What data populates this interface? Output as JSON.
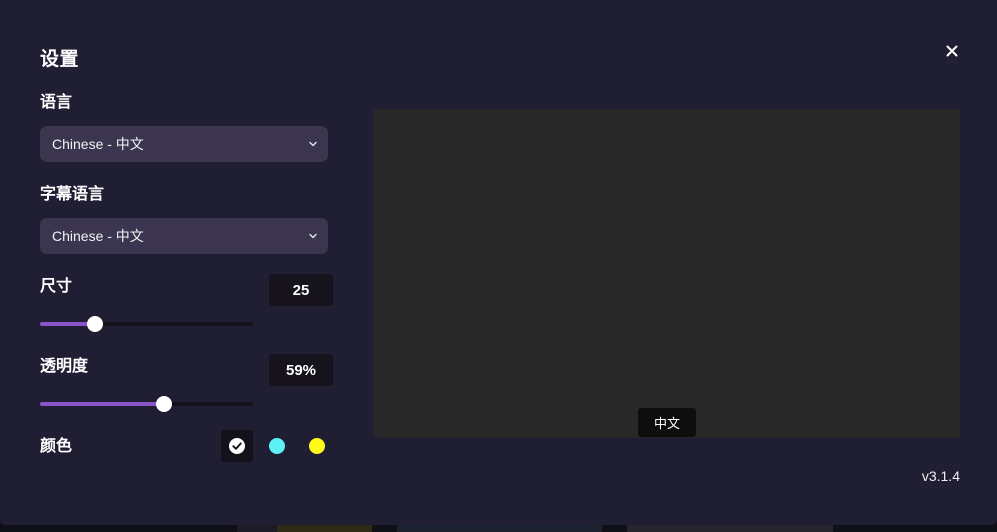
{
  "dialog": {
    "title": "设置",
    "version": "v3.1.4"
  },
  "language": {
    "label": "语言",
    "selected": "Chinese - 中文"
  },
  "subtitle_language": {
    "label": "字幕语言",
    "selected": "Chinese - 中文"
  },
  "size": {
    "label": "尺寸",
    "display": "25",
    "level": 0.258
  },
  "opacity": {
    "label": "透明度",
    "display": "59%",
    "level": 0.582
  },
  "color": {
    "label": "颜色",
    "options": [
      {
        "name": "white",
        "hex": "#ffffff",
        "selected": true
      },
      {
        "name": "cyan",
        "hex": "#5cf1f7",
        "selected": false
      },
      {
        "name": "yellow",
        "hex": "#fffa18",
        "selected": false
      }
    ]
  },
  "preview": {
    "caption": "中文",
    "background": "#282828"
  },
  "theme": {
    "dialog_bg": "#201e33",
    "select_bg": "#3b3550",
    "accent": "#8a55c9"
  }
}
